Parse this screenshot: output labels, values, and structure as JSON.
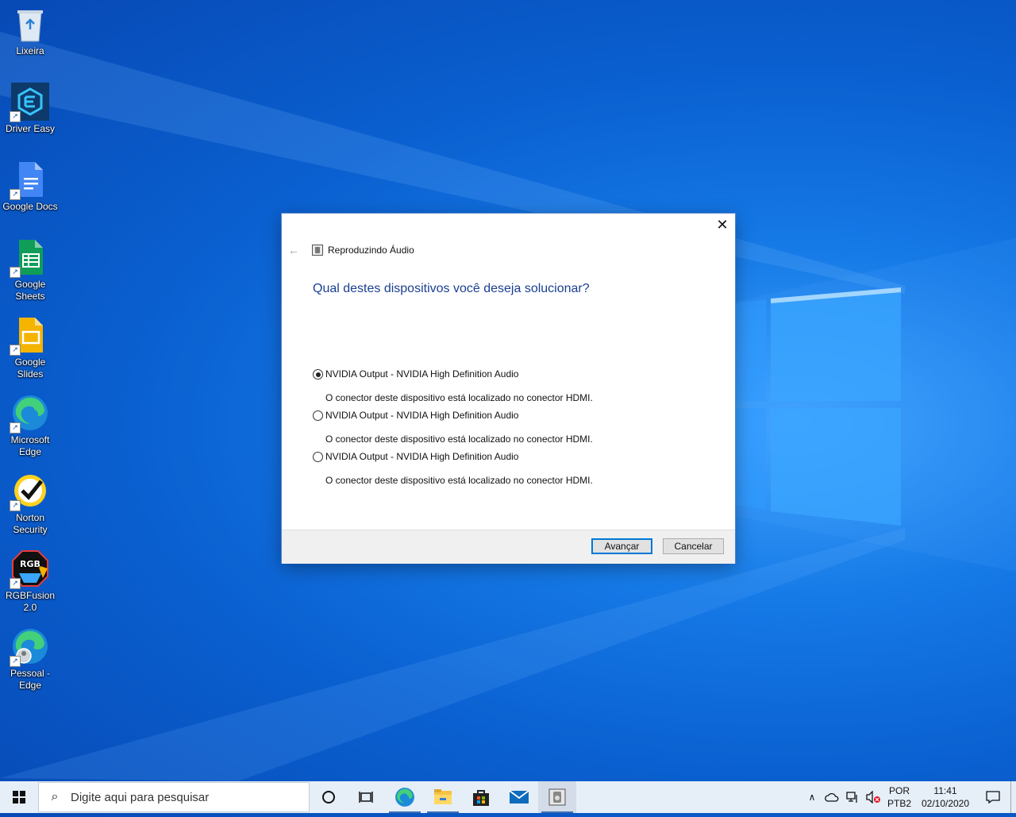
{
  "desktop": {
    "icons": [
      {
        "label": "Lixeira"
      },
      {
        "label": "Driver Easy"
      },
      {
        "label": "Google Docs"
      },
      {
        "label": "Google Sheets"
      },
      {
        "label": "Google Slides"
      },
      {
        "label": "Microsoft Edge"
      },
      {
        "label": "Norton Security"
      },
      {
        "label": "RGBFusion 2.0"
      },
      {
        "label": "Pessoal - Edge"
      }
    ]
  },
  "dialog": {
    "title": "Reproduzindo Áudio",
    "question": "Qual destes dispositivos você deseja solucionar?",
    "options": [
      {
        "label": "NVIDIA Output - NVIDIA High Definition Audio",
        "description": "O conector deste dispositivo está localizado no conector HDMI.",
        "selected": true
      },
      {
        "label": "NVIDIA Output - NVIDIA High Definition Audio",
        "description": "O conector deste dispositivo está localizado no conector HDMI.",
        "selected": false
      },
      {
        "label": "NVIDIA Output - NVIDIA High Definition Audio",
        "description": "O conector deste dispositivo está localizado no conector HDMI.",
        "selected": false
      }
    ],
    "next_label": "Avançar",
    "cancel_label": "Cancelar"
  },
  "taskbar": {
    "search_placeholder": "Digite aqui para pesquisar",
    "language_top": "POR",
    "language_bottom": "PTB2",
    "time": "11:41",
    "date": "02/10/2020"
  },
  "colors": {
    "accent": "#0078d7",
    "heading": "#1a3f92",
    "desktop": "#0a5fcf"
  }
}
